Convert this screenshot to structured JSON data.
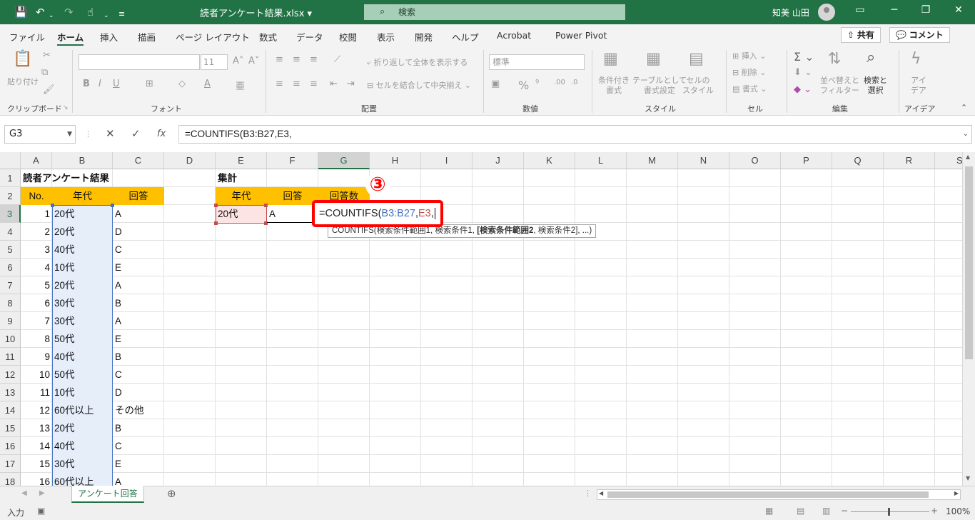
{
  "window": {
    "filename": "読者アンケート結果.xlsx",
    "search_placeholder": "検索",
    "user_name": "知美 山田"
  },
  "ribbon_tabs": [
    "ファイル",
    "ホーム",
    "挿入",
    "描画",
    "ページ レイアウト",
    "数式",
    "データ",
    "校閲",
    "表示",
    "開発",
    "ヘルプ",
    "Acrobat",
    "Power Pivot"
  ],
  "share_label": "共有",
  "comment_label": "コメント",
  "ribbon": {
    "paste_label": "貼り付け",
    "clipboard_label": "クリップボード",
    "font_label": "フォント",
    "font_size": "11",
    "wrap_text": "折り返して全体を表示する",
    "merge_center": "セルを結合して中央揃え",
    "alignment_label": "配置",
    "number_format": "標準",
    "number_label": "数値",
    "cond_format": "条件付き\n書式",
    "table_format": "テーブルとして\n書式設定",
    "cell_style": "セルの\nスタイル",
    "style_label": "スタイル",
    "insert": "挿入",
    "delete": "削除",
    "format": "書式",
    "cells_label": "セル",
    "sort_filter": "並べ替えと\nフィルター",
    "find_select": "検索と\n選択",
    "edit_label": "編集",
    "ideas": "アイ\nデア",
    "ideas_label": "アイデア"
  },
  "formula_bar": {
    "name_box": "G3",
    "formula": "=COUNTIFS(B3:B27,E3,"
  },
  "columns": [
    "A",
    "B",
    "C",
    "D",
    "E",
    "F",
    "G",
    "H",
    "I",
    "J",
    "K",
    "L",
    "M",
    "N",
    "O",
    "P",
    "Q",
    "R",
    "S"
  ],
  "rows": [
    "1",
    "2",
    "3",
    "4",
    "5",
    "6",
    "7",
    "8",
    "9",
    "10",
    "11",
    "12",
    "13",
    "14",
    "15",
    "16",
    "17",
    "18"
  ],
  "sheet": {
    "title": "読者アンケート結果",
    "headers": [
      "No.",
      "年代",
      "回答"
    ],
    "data": [
      [
        "1",
        "20代",
        "A"
      ],
      [
        "2",
        "20代",
        "D"
      ],
      [
        "3",
        "40代",
        "C"
      ],
      [
        "4",
        "10代",
        "E"
      ],
      [
        "5",
        "20代",
        "A"
      ],
      [
        "6",
        "30代",
        "B"
      ],
      [
        "7",
        "30代",
        "A"
      ],
      [
        "8",
        "50代",
        "E"
      ],
      [
        "9",
        "40代",
        "B"
      ],
      [
        "10",
        "50代",
        "C"
      ],
      [
        "11",
        "10代",
        "D"
      ],
      [
        "12",
        "60代以上",
        "その他"
      ],
      [
        "13",
        "20代",
        "B"
      ],
      [
        "14",
        "40代",
        "C"
      ],
      [
        "15",
        "30代",
        "E"
      ],
      [
        "16",
        "60代以上",
        "A"
      ]
    ],
    "summary_title": "集計",
    "summary_headers": [
      "年代",
      "回答",
      "回答数"
    ],
    "summary_row": [
      "20代",
      "A"
    ]
  },
  "edit": {
    "prefix": "=COUNTIFS(",
    "range": "B3:B27",
    "comma1": ",",
    "crit": "E3",
    "comma2": ","
  },
  "tooltip": {
    "pre": "COUNTIFS(検索条件範囲1, 検索条件1, ",
    "bold": "[検索条件範囲2",
    "post": ", 検索条件2], ...)"
  },
  "step_marker": "③",
  "sheet_tab": "アンケート回答",
  "status": {
    "mode": "入力",
    "zoom": "100%"
  },
  "colors": {
    "excel_green": "#217346",
    "header_orange": "#ffc000",
    "range_blue": "#4472c4",
    "range_red": "#c0504d",
    "highlight_red": "#ff0000"
  }
}
